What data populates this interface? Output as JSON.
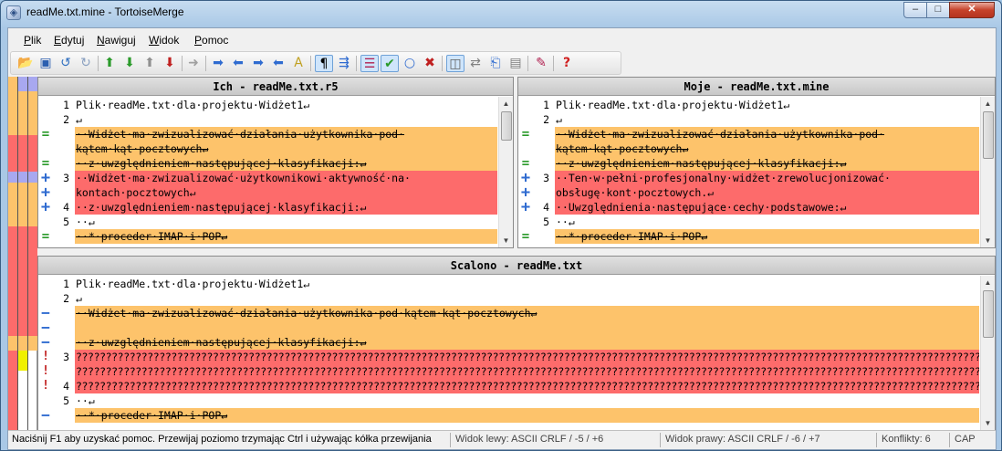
{
  "window": {
    "title": "readMe.txt.mine - TortoiseMerge",
    "minimize": "‒",
    "maximize": "□",
    "close": "✕"
  },
  "menu": [
    "Plik",
    "Edytuj",
    "Nawiguj",
    "Widok",
    "Pomoc"
  ],
  "toolbar": [
    "open-icon",
    "save-icon",
    "undo-icon",
    "redo-icon",
    "next-difference-icon",
    "previous-difference-icon",
    "first-difference-icon",
    "last-difference-icon",
    "next-inline-difference-icon",
    "next-conflict-icon",
    "previous-conflict-icon",
    "next-mark-icon",
    "previous-mark-icon",
    "inline-diff-icon",
    "whitespace-icon",
    "line-wrap-icon",
    "one-pane-view-icon",
    "mark-resolved-icon",
    "check-icon",
    "circle-icon",
    "cross-icon",
    "two-pane-view-icon",
    "switch-panes-icon",
    "patch-icon",
    "display-options-icon",
    "settings-icon",
    "help-icon"
  ],
  "theirs": {
    "header": "Ich - readMe.txt.r5",
    "lines": [
      {
        "num": "1",
        "kind": "",
        "text": "Plik·readMe.txt·dla·projektu·Widżet1↵"
      },
      {
        "num": "2",
        "kind": "",
        "text": "↵"
      },
      {
        "num": "",
        "kind": "rem",
        "icon": "=",
        "text": "··Widżet·ma·zwizualizować·działania·użytkownika·pod·"
      },
      {
        "num": "",
        "kind": "rem",
        "icon": "",
        "text": "kątem·kąt·pocztowych↵"
      },
      {
        "num": "",
        "kind": "rem",
        "icon": "=",
        "text": "··z·uwzględnieniem·następującej·klasyfikacji:↵"
      },
      {
        "num": "3",
        "kind": "chg",
        "icon": "+",
        "text": "··Widżet·ma·zwizualizować·użytkownikowi·aktywność·na·"
      },
      {
        "num": "",
        "kind": "chg",
        "icon": "+",
        "text": "kontach·pocztowych↵"
      },
      {
        "num": "4",
        "kind": "chg",
        "icon": "+",
        "text": "··z·uwzględnieniem·następującej·klasyfikacji:↵"
      },
      {
        "num": "5",
        "kind": "",
        "text": "··↵"
      },
      {
        "num": "",
        "kind": "rem",
        "icon": "=",
        "text": "··*·proceder·IMAP·i·POP↵"
      }
    ]
  },
  "mine": {
    "header": "Moje - readMe.txt.mine",
    "lines": [
      {
        "num": "1",
        "kind": "",
        "text": "Plik·readMe.txt·dla·projektu·Widżet1↵"
      },
      {
        "num": "2",
        "kind": "",
        "text": "↵"
      },
      {
        "num": "",
        "kind": "rem",
        "icon": "=",
        "text": "··Widżet·ma·zwizualizować·działania·użytkownika·pod·"
      },
      {
        "num": "",
        "kind": "rem",
        "icon": "",
        "text": "kątem·kąt·pocztowych↵"
      },
      {
        "num": "",
        "kind": "rem",
        "icon": "=",
        "text": "··z·uwzględnieniem·następującej·klasyfikacji:↵"
      },
      {
        "num": "3",
        "kind": "chg",
        "icon": "+",
        "text": "··Ten·w·pełni·profesjonalny·widżet·zrewolucjonizować·"
      },
      {
        "num": "",
        "kind": "chg",
        "icon": "+",
        "text": "obsługę·kont·pocztowych.↵"
      },
      {
        "num": "4",
        "kind": "chg",
        "icon": "+",
        "text": "··Uwzględnienia·następujące·cechy·podstawowe:↵"
      },
      {
        "num": "5",
        "kind": "",
        "text": "··↵"
      },
      {
        "num": "",
        "kind": "rem",
        "icon": "=",
        "text": "··*·proceder·IMAP·i·POP↵"
      }
    ]
  },
  "merged": {
    "header": "Scalono - readMe.txt",
    "lines": [
      {
        "num": "1",
        "kind": "",
        "text": "Plik·readMe.txt·dla·projektu·Widżet1↵"
      },
      {
        "num": "2",
        "kind": "",
        "text": "↵"
      },
      {
        "num": "",
        "kind": "rem",
        "icon": "−",
        "text": "··Widżet·ma·zwizualizować·działania·użytkownika·pod·kątem·kąt·pocztowych↵"
      },
      {
        "num": "",
        "kind": "rem",
        "icon": "−",
        "text": ""
      },
      {
        "num": "",
        "kind": "rem",
        "icon": "−",
        "text": "··z·uwzględnieniem·następującej·klasyfikacji:↵"
      },
      {
        "num": "3",
        "kind": "con",
        "icon": "!",
        "text": "????????????????????????????????????????????????????????????????????????????????????????????????????????????????????????????????????????????????????????"
      },
      {
        "num": "",
        "kind": "con",
        "icon": "!",
        "text": "????????????????????????????????????????????????????????????????????????????????????????????????????????????????????????????????????????????????????????"
      },
      {
        "num": "4",
        "kind": "con",
        "icon": "!",
        "text": "????????????????????????????????????????????????????????????????????????????????????????????????????????????????????????????????????????????????????????"
      },
      {
        "num": "5",
        "kind": "",
        "text": "··↵"
      },
      {
        "num": "",
        "kind": "rem",
        "icon": "−",
        "text": "··*·proceder·IMAP·i·POP↵"
      }
    ]
  },
  "status": {
    "help": "Naciśnij F1 aby uzyskać pomoc. Przewijaj poziomo trzymając Ctrl i używając kółka przewijania",
    "left": "Widok lewy: ASCII CRLF  / -5 / +6",
    "right": "Widok prawy: ASCII CRLF  / -6 / +7",
    "conflicts": "Konflikty: 6",
    "caps": "CAP"
  },
  "colors": {
    "removed": "#fdc36b",
    "changed": "#fd6b6b",
    "conflict": "#fd6b6b",
    "plain": "#ffffff"
  }
}
